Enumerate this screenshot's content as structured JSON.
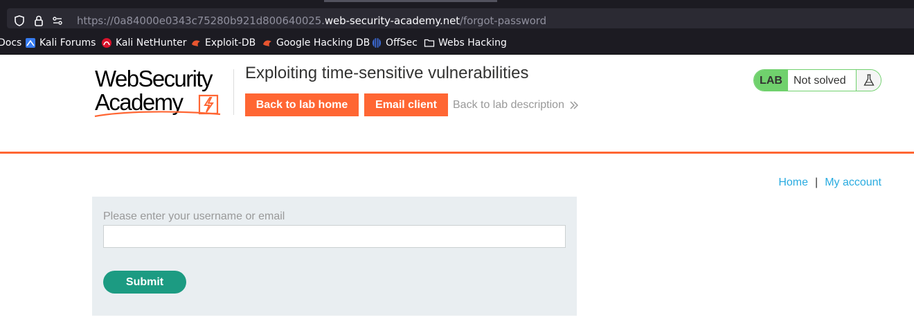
{
  "browser": {
    "url": {
      "scheme_prefix": "https://0a84000e0343c75280b921d800640025.",
      "domain": "web-security-academy.net",
      "path": "/forgot-password"
    },
    "bookmarks": [
      {
        "label": "Docs",
        "icon": "docs-icon"
      },
      {
        "label": "Kali Forums",
        "icon": "kali-icon"
      },
      {
        "label": "Kali NetHunter",
        "icon": "nethunter-icon"
      },
      {
        "label": "Exploit-DB",
        "icon": "exploit-db-icon"
      },
      {
        "label": "Google Hacking DB",
        "icon": "exploit-db-icon"
      },
      {
        "label": "OffSec",
        "icon": "offsec-icon"
      },
      {
        "label": "Webs Hacking",
        "icon": "folder-icon"
      }
    ]
  },
  "header": {
    "logo_line1": "WebSecurity",
    "logo_line2": "Academy",
    "lab_title": "Exploiting time-sensitive vulnerabilities",
    "back_to_lab_home": "Back to lab home",
    "email_client": "Email client",
    "back_to_description": "Back to lab description",
    "lab_badge": "LAB",
    "lab_status": "Not solved"
  },
  "nav": {
    "home": "Home",
    "separator": "|",
    "my_account": "My account"
  },
  "form": {
    "label": "Please enter your username or email",
    "input_value": "",
    "submit": "Submit"
  },
  "colors": {
    "accent_orange": "#ff6633",
    "lab_green": "#70d16d",
    "submit_green": "#1c9b82",
    "link_blue": "#29abe0",
    "panel_bg": "#e9eef1"
  }
}
